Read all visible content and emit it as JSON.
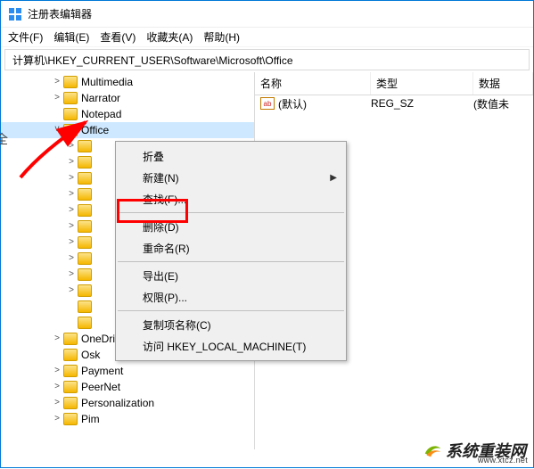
{
  "window": {
    "title": "注册表编辑器"
  },
  "menus": [
    "文件(F)",
    "编辑(E)",
    "查看(V)",
    "收藏夹(A)",
    "帮助(H)"
  ],
  "address": "计算机\\HKEY_CURRENT_USER\\Software\\Microsoft\\Office",
  "tree": [
    {
      "label": "Multimedia",
      "depth": 1,
      "expander": ">"
    },
    {
      "label": "Narrator",
      "depth": 1,
      "expander": ">"
    },
    {
      "label": "Notepad",
      "depth": 1,
      "expander": ""
    },
    {
      "label": "Office",
      "depth": 1,
      "expander": "v",
      "selected": true
    },
    {
      "label": "",
      "depth": 2,
      "expander": ">"
    },
    {
      "label": "",
      "depth": 2,
      "expander": ">"
    },
    {
      "label": "",
      "depth": 2,
      "expander": ">"
    },
    {
      "label": "",
      "depth": 2,
      "expander": ">"
    },
    {
      "label": "",
      "depth": 2,
      "expander": ">"
    },
    {
      "label": "",
      "depth": 2,
      "expander": ">"
    },
    {
      "label": "",
      "depth": 2,
      "expander": ">"
    },
    {
      "label": "",
      "depth": 2,
      "expander": ">"
    },
    {
      "label": "",
      "depth": 2,
      "expander": ">"
    },
    {
      "label": "",
      "depth": 2,
      "expander": ">"
    },
    {
      "label": "",
      "depth": 2,
      "expander": ""
    },
    {
      "label": "",
      "depth": 2,
      "expander": ""
    },
    {
      "label": "OneDrive",
      "depth": 1,
      "expander": ">"
    },
    {
      "label": "Osk",
      "depth": 1,
      "expander": ""
    },
    {
      "label": "Payment",
      "depth": 1,
      "expander": ">"
    },
    {
      "label": "PeerNet",
      "depth": 1,
      "expander": ">"
    },
    {
      "label": "Personalization",
      "depth": 1,
      "expander": ">"
    },
    {
      "label": "Pim",
      "depth": 1,
      "expander": ">"
    }
  ],
  "columns": {
    "name": "名称",
    "type": "类型",
    "data": "数据"
  },
  "rows": [
    {
      "name": "(默认)",
      "type": "REG_SZ",
      "data": "(数值未"
    }
  ],
  "context_menu": [
    {
      "label": "折叠",
      "sub": false
    },
    {
      "label": "新建(N)",
      "sub": true
    },
    {
      "label": "查找(F)...",
      "sub": false
    },
    {
      "sep": true
    },
    {
      "label": "删除(D)",
      "sub": false,
      "highlighted": true
    },
    {
      "label": "重命名(R)",
      "sub": false
    },
    {
      "sep": true
    },
    {
      "label": "导出(E)",
      "sub": false
    },
    {
      "label": "权限(P)...",
      "sub": false
    },
    {
      "sep": true
    },
    {
      "label": "复制项名称(C)",
      "sub": false
    },
    {
      "label": "访问 HKEY_LOCAL_MACHINE(T)",
      "sub": false
    }
  ],
  "watermark": {
    "brand": "系统重装网",
    "url": "www.xtcz.net"
  }
}
